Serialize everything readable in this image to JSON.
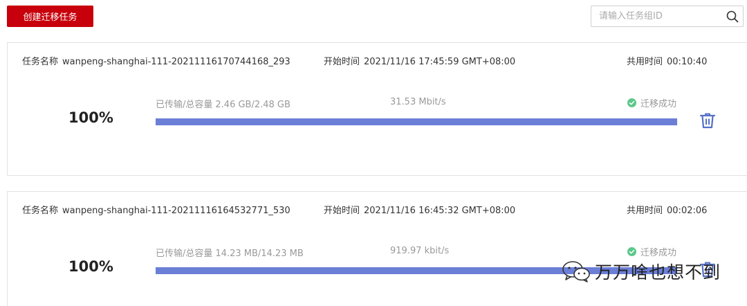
{
  "toolbar": {
    "create_label": "创建迁移任务",
    "search_placeholder": "请输入任务组ID"
  },
  "labels": {
    "task_name": "任务名称",
    "start_time": "开始时间",
    "used_time": "共用时间",
    "transferred": "已传输/总容量"
  },
  "tasks": [
    {
      "name": "wanpeng-shanghai-111-20211116170744168_293",
      "start_time": "2021/11/16 17:45:59 GMT+08:00",
      "used_time": "00:10:40",
      "percent": "100%",
      "progress": 1.0,
      "transferred": "2.46 GB/2.48 GB",
      "speed": "31.53 Mbit/s",
      "status": "迁移成功"
    },
    {
      "name": "wanpeng-shanghai-111-20211116164532771_530",
      "start_time": "2021/11/16 16:45:32 GMT+08:00",
      "used_time": "00:02:06",
      "percent": "100%",
      "progress": 1.0,
      "transferred": "14.23 MB/14.23 MB",
      "speed": "919.97 kbit/s",
      "status": "迁移成功"
    }
  ],
  "watermark": {
    "text": "万万啥也想不到"
  },
  "colors": {
    "brand_red": "#c7000b",
    "progress": "#6b7fd7",
    "success": "#5cc88b",
    "delete_icon": "#5470c6"
  },
  "icons": {
    "search": "search-icon",
    "success": "check-circle-icon",
    "delete": "trash-icon",
    "watermark": "wechat-icon"
  }
}
